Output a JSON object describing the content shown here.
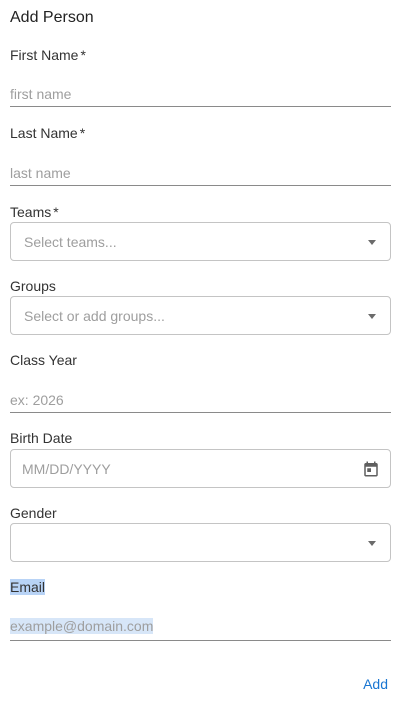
{
  "title": "Add Person",
  "fields": {
    "first_name": {
      "label": "First Name",
      "required": "*",
      "placeholder": "first name"
    },
    "last_name": {
      "label": "Last Name",
      "required": "*",
      "placeholder": "last name"
    },
    "teams": {
      "label": "Teams",
      "required": "*",
      "placeholder": "Select teams..."
    },
    "groups": {
      "label": "Groups",
      "placeholder": "Select or add groups..."
    },
    "class_year": {
      "label": "Class Year",
      "placeholder": "ex: 2026"
    },
    "birth_date": {
      "label": "Birth Date",
      "placeholder": "MM/DD/YYYY"
    },
    "gender": {
      "label": "Gender",
      "value": ""
    },
    "email": {
      "label": "Email",
      "placeholder": "example@domain.com"
    }
  },
  "actions": {
    "add_label": "Add"
  },
  "icons": {
    "dropdown": "caret-down-icon",
    "calendar": "calendar-icon"
  },
  "colors": {
    "accent": "#1976d2",
    "selection": "#b8d3f6"
  }
}
